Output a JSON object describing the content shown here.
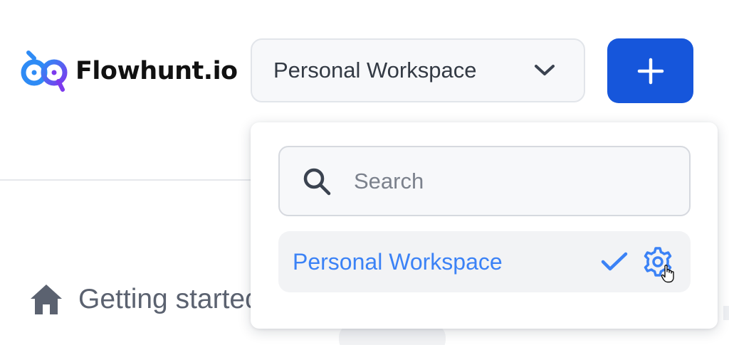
{
  "app": {
    "logo_text": "Flowhunt.io",
    "logo_icon": "flowhunt-logo-icon"
  },
  "header": {
    "workspace_selector": {
      "selected_label": "Personal Workspace",
      "icon": "chevron-down-icon"
    },
    "add_button": {
      "icon": "plus-icon",
      "color": "#1656db"
    }
  },
  "dropdown": {
    "search": {
      "placeholder": "Search",
      "value": "",
      "icon": "search-icon"
    },
    "items": [
      {
        "label": "Personal Workspace",
        "selected": true,
        "selected_icon": "check-icon",
        "settings_icon": "gear-icon",
        "color": "#3b82f6"
      }
    ]
  },
  "sidebar": {
    "items": [
      {
        "label": "Getting started",
        "icon": "home-icon"
      }
    ]
  }
}
